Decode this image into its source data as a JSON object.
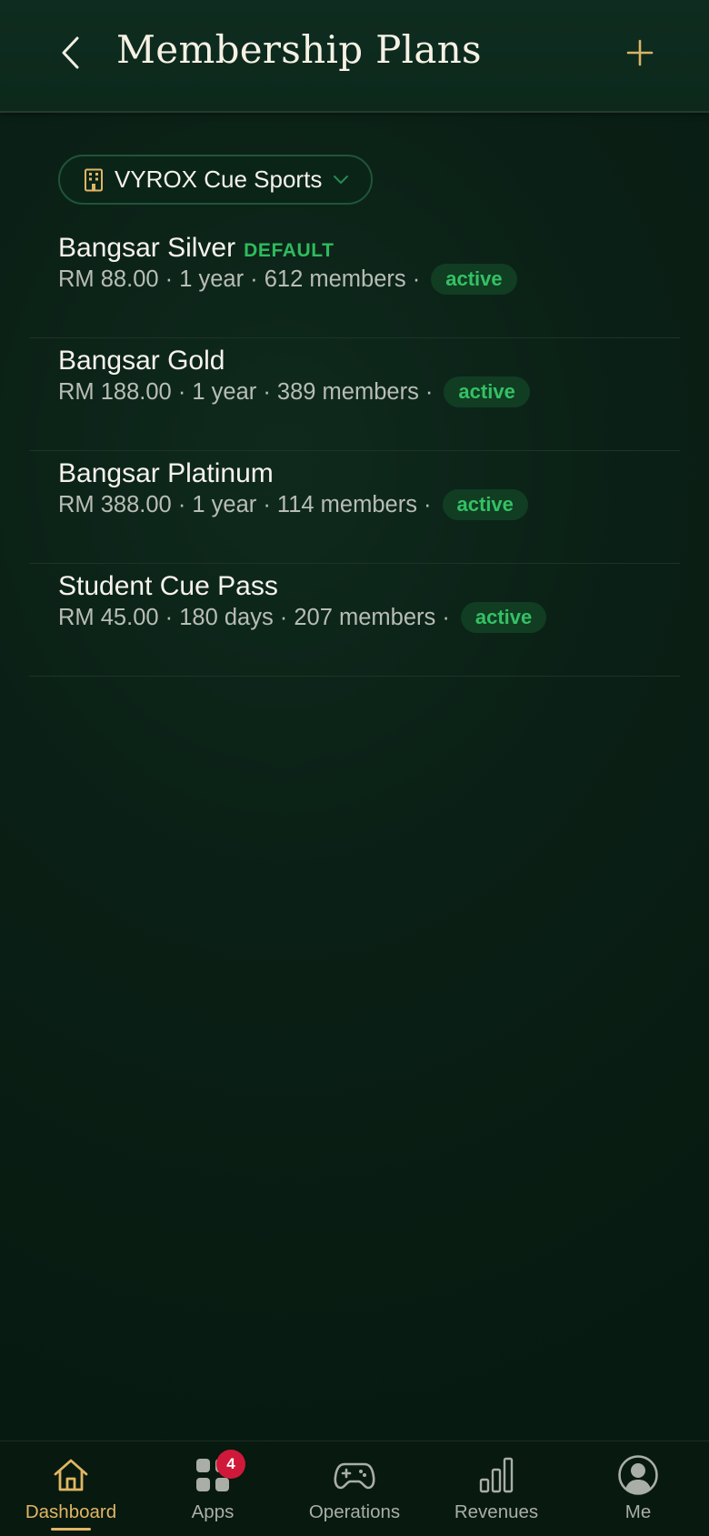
{
  "header": {
    "title": "Membership Plans",
    "back_icon": "chevron-left-icon",
    "add_icon": "plus-icon"
  },
  "venue_selector": {
    "label": "VYROX Cue Sports",
    "icon": "building-icon",
    "dropdown_icon": "chevron-down-icon"
  },
  "plans": [
    {
      "name": "Bangsar Silver",
      "tag": "DEFAULT",
      "meta": "RM 88.00 · 1 year · 612 members ·",
      "status": "active"
    },
    {
      "name": "Bangsar Gold",
      "tag": "",
      "meta": "RM 188.00 · 1 year · 389 members ·",
      "status": "active"
    },
    {
      "name": "Bangsar Platinum",
      "tag": "",
      "meta": "RM 388.00 · 1 year · 114 members ·",
      "status": "active"
    },
    {
      "name": "Student Cue Pass",
      "tag": "",
      "meta": "RM 45.00 · 180 days · 207 members ·",
      "status": "active"
    }
  ],
  "tab_bar": {
    "tabs": [
      {
        "label": "Dashboard",
        "icon": "home-icon",
        "active": true
      },
      {
        "label": "Apps",
        "icon": "apps-grid-icon",
        "badge": "4"
      },
      {
        "label": "Operations",
        "icon": "gamepad-icon"
      },
      {
        "label": "Revenues",
        "icon": "bar-chart-icon"
      },
      {
        "label": "Me",
        "icon": "user-avatar-icon"
      }
    ]
  },
  "colors": {
    "accent_gold": "#e0b664",
    "status_green": "#34c164",
    "badge_red": "#d0193a",
    "background": "#0a1f15"
  }
}
